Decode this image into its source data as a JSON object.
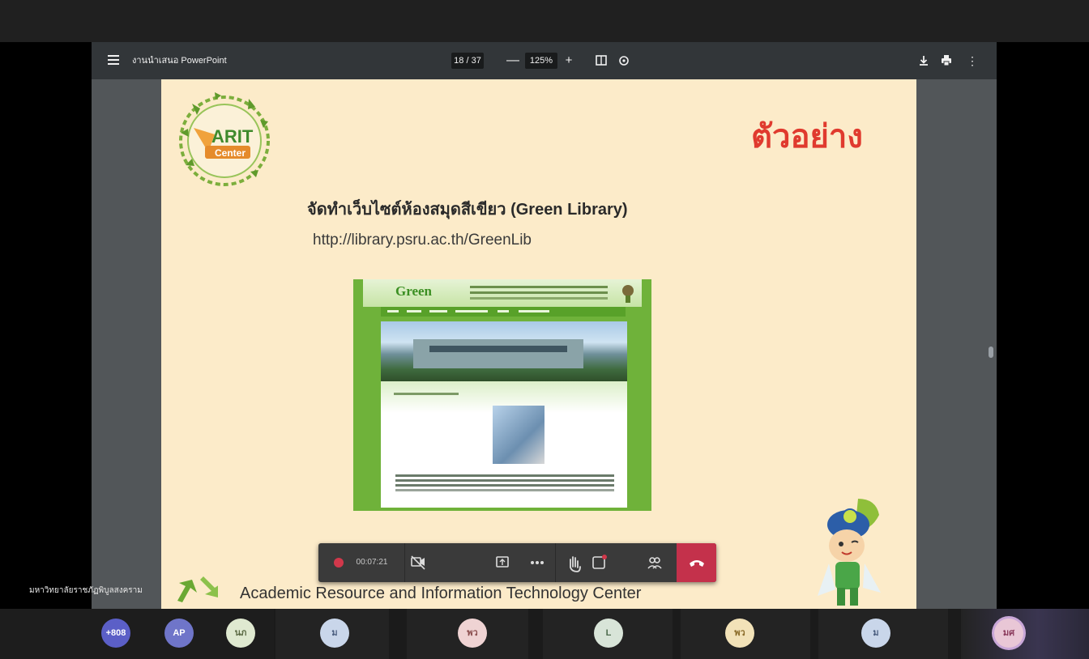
{
  "pdf_viewer": {
    "doc_title": "งานนำเสนอ PowerPoint",
    "page_indicator": "18 / 37",
    "zoom": "125%",
    "minus": "—",
    "plus": "+",
    "more": "⋮"
  },
  "slide": {
    "heading": "ตัวอย่าง",
    "title": "จัดทำเว็บไซต์ห้องสมุดสีเขียว (Green Library)",
    "url": "http://library.psru.ac.th/GreenLib",
    "footer": "Academic Resource and Information Technology Center",
    "logo_text": "ARIT",
    "logo_subtext": "Center",
    "site_logo": "Green"
  },
  "meeting": {
    "recording_time": "00:07:21",
    "speaker_name": "มหาวิทยาลัยราชภัฏพิบูลสงคราม",
    "hangup_icon": "phone-hangup-icon",
    "colors": {
      "hangup": "#c4314b",
      "record": "#d1384b"
    }
  },
  "participants": [
    {
      "initials": "+808",
      "color": "#5b5fc7",
      "text": "#ffffff"
    },
    {
      "initials": "AP",
      "color": "#6f75c9",
      "text": "#ffffff"
    },
    {
      "initials": "นภ",
      "color": "#dfe9d0",
      "text": "#5c6b45"
    },
    {
      "initials": "ม",
      "color": "#c9d6ea",
      "text": "#4c5f80"
    },
    {
      "initials": "พว",
      "color": "#efd3d3",
      "text": "#8a4d4d"
    },
    {
      "initials": "L",
      "color": "#d8e4d8",
      "text": "#4d6b4d"
    },
    {
      "initials": "พว",
      "color": "#f2e2b8",
      "text": "#8a6b28"
    },
    {
      "initials": "ม",
      "color": "#c9d6ea",
      "text": "#4c5f80"
    },
    {
      "initials": "มศ",
      "color": "#e9c7d6",
      "text": "#8a3a5c"
    }
  ]
}
